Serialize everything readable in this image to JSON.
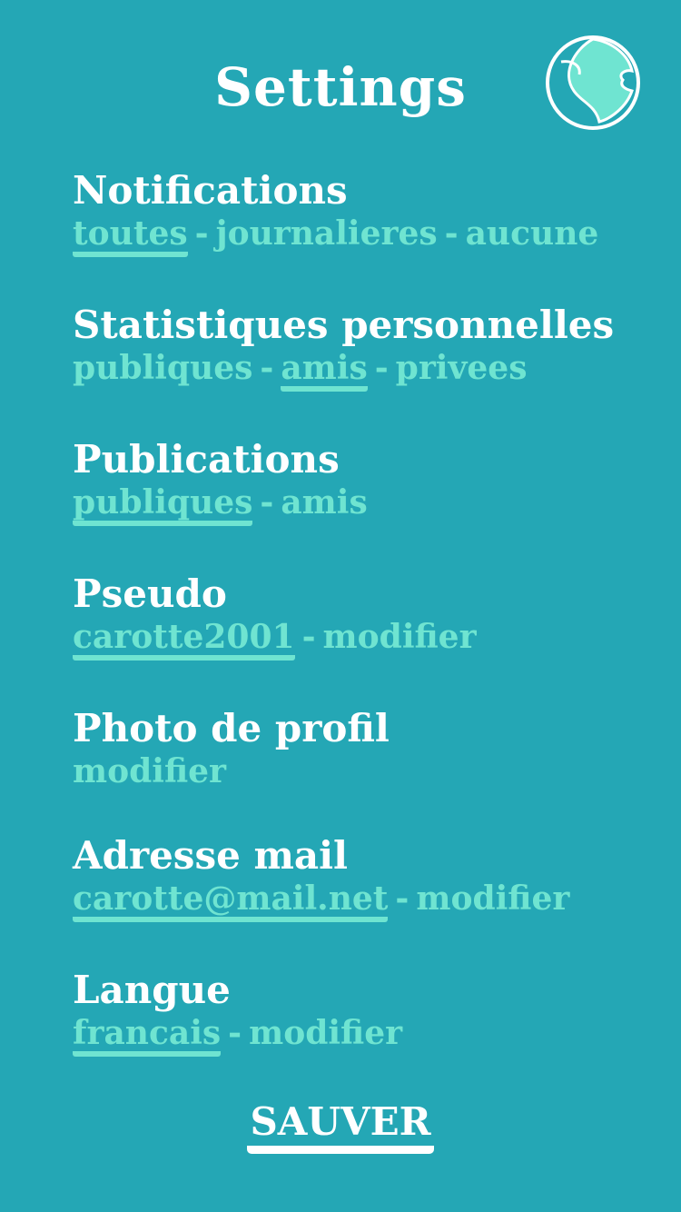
{
  "header": {
    "title": "Settings",
    "globe_icon": "globe-icon"
  },
  "colors": {
    "background": "#24a7b5",
    "accent": "#6fe4d1",
    "text": "#ffffff"
  },
  "separator": "-",
  "sections": {
    "notifications": {
      "title": "Notifications",
      "options": [
        {
          "label": "toutes",
          "selected": true
        },
        {
          "label": "journalieres",
          "selected": false
        },
        {
          "label": "aucune",
          "selected": false
        }
      ]
    },
    "stats": {
      "title": "Statistiques personnelles",
      "options": [
        {
          "label": "publiques",
          "selected": false
        },
        {
          "label": "amis",
          "selected": true
        },
        {
          "label": "privees",
          "selected": false
        }
      ]
    },
    "publications": {
      "title": "Publications",
      "options": [
        {
          "label": "publiques",
          "selected": true
        },
        {
          "label": "amis",
          "selected": false
        }
      ]
    },
    "pseudo": {
      "title": "Pseudo",
      "value": "carotte2001",
      "action": "modifier"
    },
    "photo": {
      "title": "Photo de profil",
      "action": "modifier"
    },
    "email": {
      "title": "Adresse mail",
      "value": "carotte@mail.net",
      "action": "modifier"
    },
    "langue": {
      "title": "Langue",
      "value": "francais",
      "action": "modifier"
    }
  },
  "footer": {
    "save_label": "SAUVER"
  }
}
